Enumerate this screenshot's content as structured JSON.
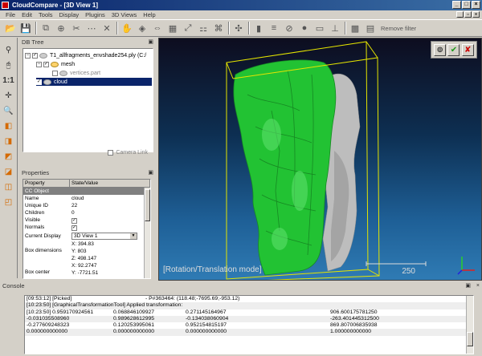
{
  "window": {
    "title": "CloudCompare - [3D View 1]"
  },
  "menu": [
    "File",
    "Edit",
    "Tools",
    "Display",
    "Plugins",
    "3D Views",
    "Help"
  ],
  "toolbar": {
    "remove_filter_label": "Remove filter"
  },
  "db_tree": {
    "title": "DB Tree",
    "items": [
      {
        "label": "T1_allfragments_envshade254.ply (C:/",
        "checked": true,
        "expanded": true,
        "level": 0
      },
      {
        "label": "mesh",
        "checked": true,
        "expanded": true,
        "level": 1
      },
      {
        "label": "vertices.part",
        "checked": false,
        "level": 2
      },
      {
        "label": "cloud",
        "checked": true,
        "level": 1,
        "selected": true
      }
    ],
    "camera_link_label": "Camera Link"
  },
  "properties": {
    "title": "Properties",
    "col_property": "Property",
    "col_value": "State/Value",
    "section": "CC Object",
    "rows": [
      {
        "k": "Name",
        "v": "cloud"
      },
      {
        "k": "Unique ID",
        "v": "22"
      },
      {
        "k": "Children",
        "v": "0"
      },
      {
        "k": "Visible",
        "v": "✓"
      },
      {
        "k": "Normals",
        "v": "✓"
      }
    ],
    "current_display_label": "Current Display",
    "current_display_value": "3D View 1",
    "box_dimensions_label": "Box dimensions",
    "box_dimensions": [
      "X: 394.83",
      "Y: 803",
      "Z: 498.147"
    ],
    "box_center_label": "Box center",
    "box_center": [
      "X: 92.2747",
      "Y: -7721.51"
    ]
  },
  "view3d": {
    "mode_label": "[Rotation/Translation mode]",
    "scale_value": "250",
    "colors": {
      "selected_cloud": "#22c233",
      "bbox": "#e5e500",
      "unselected": "#c8c8c8"
    }
  },
  "console": {
    "title": "Console",
    "lines": [
      {
        "c1": "[09:53:12] [Picked]",
        "c2": "",
        "c3": "- P#363464: (118.48;-7695.69;-953.12)",
        "c4": ""
      },
      {
        "c1": "[10:23:50] [GraphicalTransformationTool] Applied transformation:",
        "c2": "",
        "c3": "",
        "c4": ""
      },
      {
        "c1": "[10:23:50] 0.959170924561",
        "c2": "0.068846109927",
        "c3": "0.271145164967",
        "c4": "906.600175781250"
      },
      {
        "c1": "-0.031035508960",
        "c2": "0.989628612995",
        "c3": "-0.134038060904",
        "c4": "-263.401445312500"
      },
      {
        "c1": "-0.277609248323",
        "c2": "0.120253995061",
        "c3": "0.952154815197",
        "c4": "869.807006835938"
      },
      {
        "c1": "0.000000000000",
        "c2": "0.000000000000",
        "c3": "0.000000000000",
        "c4": "1.000000000000"
      }
    ]
  }
}
